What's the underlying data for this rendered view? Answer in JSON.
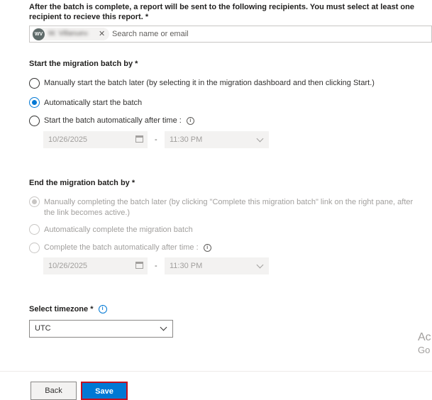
{
  "recipients": {
    "instructions": "After the batch is complete, a report will be sent to the following recipients. You must select at least one recipient to recieve this report. *",
    "chip_initials": "WV",
    "chip_name": "W. Villanueva",
    "remove_glyph": "✕",
    "placeholder": "Search name or email"
  },
  "start": {
    "heading": "Start the migration batch by *",
    "options": [
      {
        "label": "Manually start the batch later (by selecting it in the migration dashboard and then clicking Start.)",
        "checked": false
      },
      {
        "label": "Automatically start the batch",
        "checked": true
      },
      {
        "label": "Start the batch automatically after time :",
        "checked": false
      }
    ],
    "date": "10/26/2025",
    "time": "11:30 PM",
    "separator": "-"
  },
  "end": {
    "heading": "End the migration batch by *",
    "options": [
      {
        "label_line1": "Manually completing the batch later (by clicking \"Complete this migration batch\" link on the right pane, after",
        "label_line2": "the link becomes active.)",
        "checked": true,
        "disabled": true
      },
      {
        "label": "Automatically complete the migration batch",
        "checked": false,
        "disabled": true
      },
      {
        "label": "Complete the batch automatically after time :",
        "checked": false,
        "disabled": true
      }
    ],
    "date": "10/26/2025",
    "time": "11:30 PM",
    "separator": "-"
  },
  "timezone": {
    "label": "Select timezone *",
    "value": "UTC"
  },
  "footer": {
    "back_label": "Back",
    "save_label": "Save"
  },
  "watermark": {
    "line1": "Ac",
    "line2": "Go"
  },
  "colors": {
    "accent": "#0078d4",
    "highlight_border": "#c50f1f"
  }
}
